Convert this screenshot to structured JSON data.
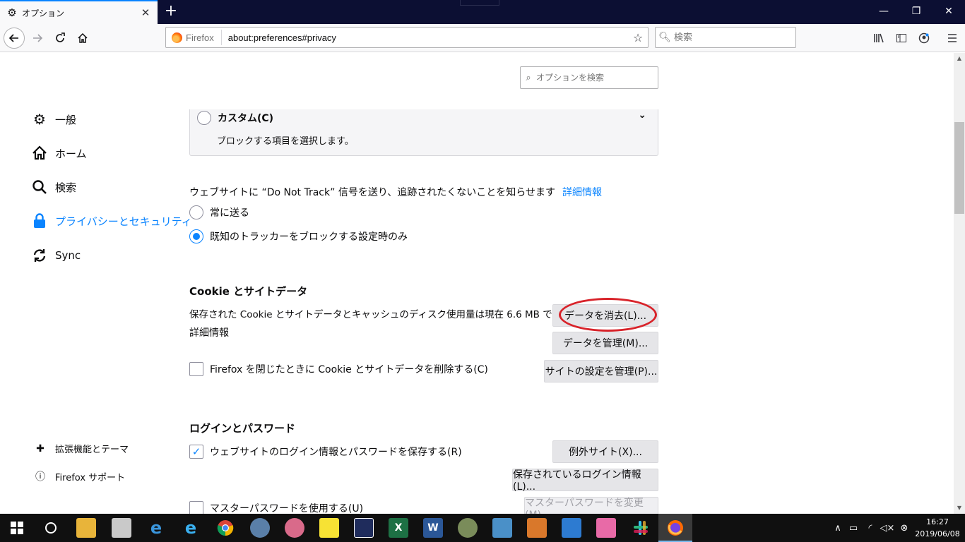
{
  "tab": {
    "title": "オプション",
    "icon": "gear-icon",
    "close_label": "✕"
  },
  "newtab_label": "+",
  "window_controls": {
    "minimize": "—",
    "restore": "❐",
    "close": "✕"
  },
  "navbar": {
    "identity_label": "Firefox",
    "url": "about:preferences#privacy",
    "search_placeholder": "検索"
  },
  "options_search_placeholder": "オプションを検索",
  "sidebar": {
    "items": [
      {
        "label": "一般",
        "icon": "gear-icon"
      },
      {
        "label": "ホーム",
        "icon": "home-icon"
      },
      {
        "label": "検索",
        "icon": "search-icon"
      },
      {
        "label": "プライバシーとセキュリティ",
        "icon": "lock-icon",
        "selected": true
      },
      {
        "label": "Sync",
        "icon": "sync-icon"
      }
    ],
    "footer": [
      {
        "label": "拡張機能とテーマ",
        "icon": "puzzle-icon"
      },
      {
        "label": "Firefox サポート",
        "icon": "help-icon"
      }
    ]
  },
  "custom": {
    "label": "カスタム(C)",
    "desc": "ブロックする項目を選択します。"
  },
  "dnt": {
    "text": "ウェブサイトに “Do Not Track” 信号を送り、追跡されたくないことを知らせます",
    "link": "詳細情報",
    "options": [
      "常に送る",
      "既知のトラッカーをブロックする設定時のみ"
    ],
    "selected_index": 1
  },
  "cookies": {
    "heading": "Cookie とサイトデータ",
    "usage": "保存された Cookie とサイトデータとキャッシュのディスク使用量は現在 6.6 MB です。",
    "link": "詳細情報",
    "delete_on_close": "Firefox を閉じたときに Cookie とサイトデータを削除する(C)",
    "delete_on_close_checked": false,
    "clear_button": "データを消去(L)...",
    "manage_button": "データを管理(M)...",
    "site_settings_button": "サイトの設定を管理(P)..."
  },
  "logins": {
    "heading": "ログインとパスワード",
    "save_logins": "ウェブサイトのログイン情報とパスワードを保存する(R)",
    "save_logins_checked": true,
    "exceptions_button": "例外サイト(X)...",
    "saved_logins_button": "保存されているログイン情報(L)...",
    "master_password": "マスターパスワードを使用する(U)",
    "master_password_checked": false,
    "change_master_button": "マスターパスワードを変更(M)..."
  },
  "colors": {
    "accent": "#0a84ff",
    "highlight": "#d8232a",
    "tabbar": "#0c0f33"
  },
  "taskbar": {
    "icons": [
      "windows-start-icon",
      "cortana-icon",
      "file-explorer-icon",
      "mail-icon",
      "edge-icon",
      "internet-explorer-icon",
      "chrome-icon",
      "app-icon",
      "paint-icon",
      "sticky-notes-icon",
      "app-icon",
      "excel-icon",
      "word-icon",
      "paint-icon",
      "app-icon",
      "app-icon",
      "remote-desktop-icon",
      "app-icon",
      "slack-icon",
      "firefox-icon"
    ],
    "excel_letter": "X",
    "word_letter": "W",
    "clock_time": "16:27",
    "clock_date": "2019/06/08"
  }
}
